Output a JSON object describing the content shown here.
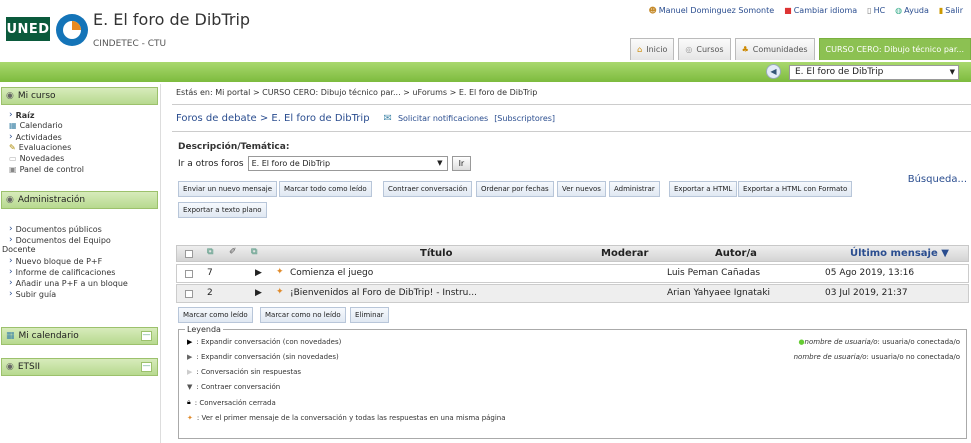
{
  "header": {
    "logo_text": "UNED",
    "title": "E. El foro de DibTrip",
    "subtitle": "CINDETEC - CTU",
    "top_links": [
      "Manuel Dominguez Somonte",
      "Cambiar idioma",
      "HC",
      "Ayuda",
      "Salir"
    ],
    "tabs": [
      "Inicio",
      "Cursos",
      "Comunidades",
      "CURSO CERO: Dibujo técnico par..."
    ],
    "forum_selector": "E. El foro de DibTrip"
  },
  "sidebar": {
    "mi_curso": "Mi curso",
    "mi_curso_items": [
      "Raíz",
      "Calendario",
      "Actividades",
      "Evaluaciones",
      "Novedades",
      "Panel de control"
    ],
    "administracion": "Administración",
    "admin_items": [
      "Documentos públicos",
      "Documentos del Equipo",
      "Docente",
      "Nuevo bloque de P+F",
      "Informe de calificaciones",
      "Añadir una P+F a un bloque",
      "Subir guía"
    ],
    "mi_calendario": "Mi calendario",
    "etsii": "ETSII"
  },
  "main": {
    "breadcrumb": "Estás en: Mi portal > CURSO CERO: Dibujo técnico par... > uForums > E. El foro de DibTrip",
    "forum_path": "Foros de debate > E. El foro de DibTrip",
    "notify_link": "Solicitar notificaciones",
    "subscribers": "[Subscriptores]",
    "desc_label": "Descripción/Temática:",
    "goto_label": "Ir a otros foros",
    "goto_value": "E. El foro de DibTrip",
    "go_button": "Ir",
    "search": "Búsqueda...",
    "action_buttons": [
      "Enviar un nuevo mensaje",
      "Marcar todo como leído",
      "Contraer conversación",
      "Ordenar por fechas",
      "Ver nuevos",
      "Administrar",
      "Exportar a HTML",
      "Exportar a HTML con Formato",
      "Exportar a texto plano"
    ],
    "table": {
      "col_title": "Título",
      "col_moderar": "Moderar",
      "col_author": "Autor/a",
      "col_last": "Último mensaje",
      "rows": [
        {
          "count": "7",
          "title": "Comienza el juego",
          "author": "Luis Peman Cañadas",
          "last": "05 Ago 2019, 13:16"
        },
        {
          "count": "2",
          "title": "¡Bienvenidos al Foro de DibTrip! - Instru...",
          "author": "Arian Yahyaee Ignataki",
          "last": "03 Jul 2019, 21:37"
        }
      ]
    },
    "bottom_buttons": [
      "Marcar como leído",
      "Marcar como no leído",
      "Eliminar"
    ],
    "legend": {
      "title": "Leyenda",
      "items": [
        ": Expandir conversación (con novedades)",
        ": Expandir conversación (sin novedades)",
        ": Conversación sin respuestas",
        ": Contraer conversación",
        ": Conversación cerrada",
        ": Ver el primer mensaje de la conversación y todas las respuestas en una misma página"
      ],
      "online_name": "nombre de usuaria/o",
      "online_text": ": usuaria/o conectada/o",
      "offline_name": "nombre de usuaria/o",
      "offline_text": ": usuaria/o no conectada/o"
    }
  }
}
